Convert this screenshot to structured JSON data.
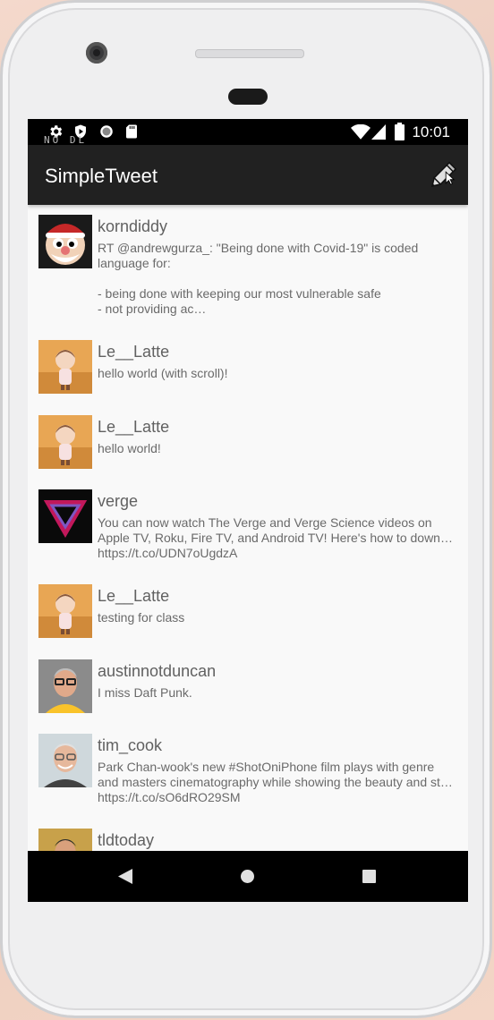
{
  "status_bar": {
    "time": "10:01",
    "ghost_text": "NO DL"
  },
  "app_bar": {
    "title": "SimpleTweet",
    "compose_icon": "pencil-icon"
  },
  "tweets": [
    {
      "handle": "korndiddy",
      "body": "RT @andrewgurza_: \"Being done with Covid-19\" is coded language for:\n\n- being done with keeping our most vulnerable safe\n- not providing ac…",
      "avatar": "santa-avatar"
    },
    {
      "handle": "Le__Latte",
      "body": "hello world (with scroll)!",
      "avatar": "villager-avatar"
    },
    {
      "handle": "Le__Latte",
      "body": "hello world!",
      "avatar": "villager-avatar"
    },
    {
      "handle": "verge",
      "body": "You can now watch The Verge and Verge Science videos on Apple TV, Roku, Fire TV, and Android TV! Here's how to down…\nhttps://t.co/UDN7oUgdzA",
      "avatar": "verge-logo-avatar"
    },
    {
      "handle": "Le__Latte",
      "body": "testing for class",
      "avatar": "villager-avatar"
    },
    {
      "handle": "austinnotduncan",
      "body": "I miss Daft Punk.",
      "avatar": "person-avatar"
    },
    {
      "handle": "tim_cook",
      "body": "Park Chan-wook's new #ShotOniPhone film plays with genre and masters cinematography while showing the beauty and st… https://t.co/sO6dRO29SM",
      "avatar": "person-avatar"
    },
    {
      "handle": "tldtoday",
      "body": "",
      "avatar": "person-avatar"
    }
  ],
  "colors": {
    "app_bar": "#212121",
    "status_bar": "#000000",
    "background": "#f9f9f9",
    "handle_text": "#616161",
    "body_text": "#6a6a6a"
  }
}
